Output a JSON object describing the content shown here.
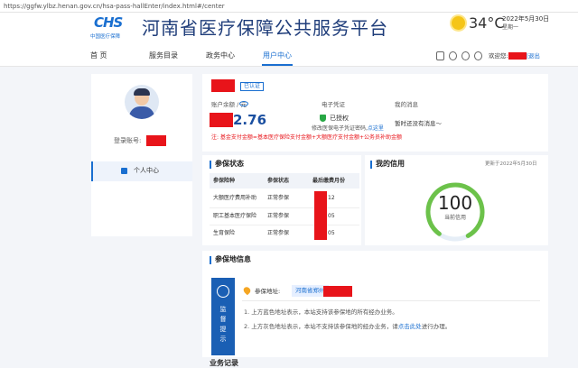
{
  "browser": {
    "url": "https://ggfw.ylbz.henan.gov.cn/hsa-pass-hallEnter/index.html#/center"
  },
  "header": {
    "logo_mark": "CHS",
    "logo_sub": "中国医疗保障",
    "site_title": "河南省医疗保障公共服务平台",
    "temperature": "34°C",
    "date": "2022年5月30日",
    "weekday": "星期一"
  },
  "nav": {
    "items": [
      {
        "label": "首 页"
      },
      {
        "label": "服务目录"
      },
      {
        "label": "政务中心"
      },
      {
        "label": "用户中心"
      }
    ],
    "welcome": "欢迎您:",
    "logout": "|退出"
  },
  "sidebar": {
    "login_label": "登录账号:",
    "menu_item": "个人中心"
  },
  "account": {
    "verified_badge": "已认证",
    "balance_label": "账户余额 / 元",
    "balance_value": "2.76",
    "voucher_label": "电子凭证",
    "voucher_status": "已授权",
    "voucher_note": "修改医保电子凭证密码,",
    "voucher_link": "点这里",
    "messages_label": "我的消息",
    "messages_value": "暂时还没有消息～",
    "note": "注: 基金支付金额=基本医疗保险支付金额+大额医疗支付金额+公务员补助金额"
  },
  "status": {
    "title": "参保状态",
    "columns": [
      "参保险种",
      "参保状态",
      "最后缴费月份"
    ],
    "rows": [
      {
        "type": "大额医疗费用补助",
        "status": "正常参保",
        "month": "12"
      },
      {
        "type": "职工基本医疗保险",
        "status": "正常参保",
        "month": "05"
      },
      {
        "type": "生育保险",
        "status": "正常参保",
        "month": "05"
      }
    ]
  },
  "credit": {
    "title": "我的信用",
    "updated": "更新于2022年5月30日",
    "score": "100",
    "score_label": "当前信用",
    "score_fraction": 0.82
  },
  "insured": {
    "title": "参保地信息",
    "supervise_label": "监督提示",
    "address_label": "参保地址:",
    "address_value": "河南省郑州",
    "line1": "1. 上方蓝色地址表示，本站支持该参保地的所有经办业务。",
    "line2_a": "2. 上方灰色地址表示，本站不支持该参保地的经办业务，请",
    "line2_link": "点击此处",
    "line2_b": "进行办理。"
  },
  "bottom_section": {
    "title": "业务记录"
  }
}
